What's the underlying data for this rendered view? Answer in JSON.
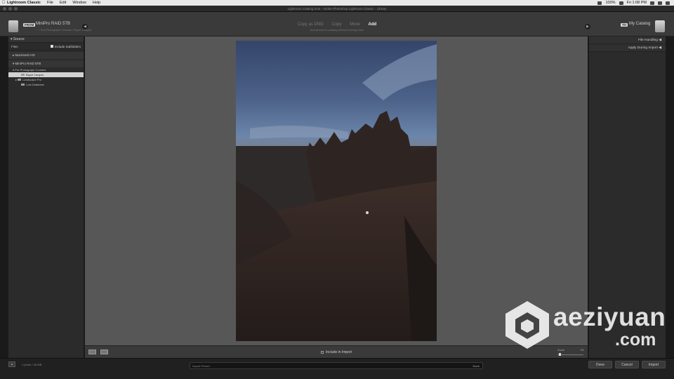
{
  "menubar": {
    "app": "Lightroom Classic",
    "items": [
      "File",
      "Edit",
      "Window",
      "Help"
    ],
    "battery": "100%",
    "clock": "Fri 1:08 PM"
  },
  "window": {
    "title": "Lightroom Catalog.lrcat - Adobe Photoshop Lightroom Classic - Library"
  },
  "header": {
    "from_badge": "FROM",
    "from_name": "MiniPro RAID 5TB",
    "from_path": "... / Pre-Photograph Courses / Bryce Canyon",
    "modes": [
      "Copy as DNG",
      "Copy",
      "Move",
      "Add"
    ],
    "active_mode": "Add",
    "mode_sub": "Add photos to catalog without moving them",
    "to_badge": "TO",
    "to_name": "My Catalog"
  },
  "left_panel": {
    "section": "Source",
    "files_label": "Files",
    "include_sub": "Include Subfolders",
    "drive1": "Macintosh HD",
    "drive2": "MiniPro RAID 5TB",
    "tree": {
      "parent": "Pre-Photograph Courses",
      "items": [
        "Bryce Canyon",
        "Landscape Pro",
        "Lost Database"
      ]
    }
  },
  "center": {
    "include_label": "Include in Import",
    "zoom_label": "Zoom",
    "zoom_value": "Fit",
    "zoom_level": 0.05
  },
  "right_panel": {
    "rows": [
      "File Handling",
      "Apply During Import"
    ]
  },
  "bottom": {
    "summary": "1 photo / 26 MB",
    "preset_label": "Import Preset :",
    "preset_value": "None",
    "done": "Done",
    "cancel": "Cancel",
    "import": "Import"
  },
  "watermark": {
    "word": "aeziyuan",
    "domain": ".com"
  },
  "colors": {
    "panel": "#2b2b2b",
    "center": "#575757",
    "accent": "#f0f0f0"
  }
}
